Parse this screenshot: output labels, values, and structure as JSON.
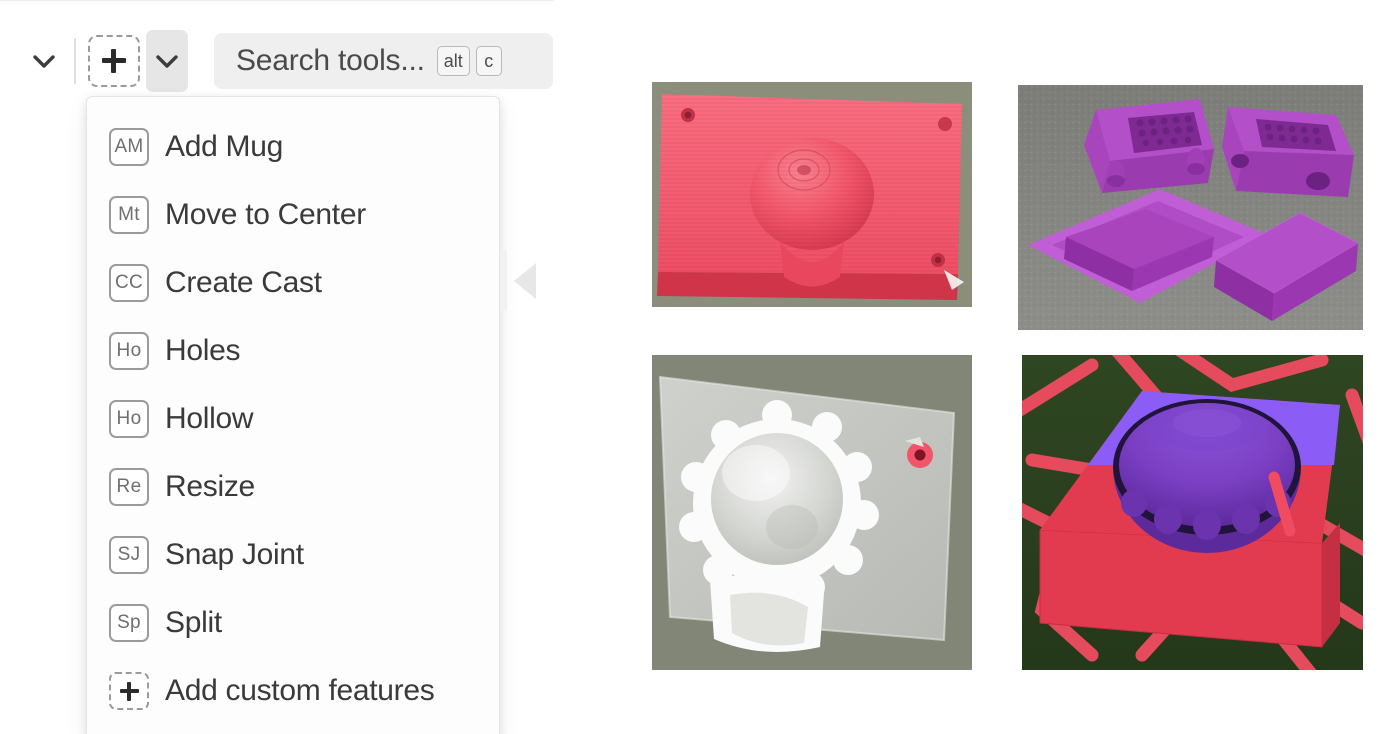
{
  "toolbar": {
    "collapse_chevron_icon": "chevron-down-icon",
    "add_tool_icon": "plus-icon",
    "add_tool_dropdown_icon": "chevron-down-icon",
    "search": {
      "placeholder": "Search tools...",
      "value": "",
      "shortcut_keys": [
        "alt",
        "c"
      ]
    }
  },
  "dropdown_menu": {
    "items": [
      {
        "badge": "AM",
        "label": "Add Mug",
        "badge_style": "solid"
      },
      {
        "badge": "Mt",
        "label": "Move to Center",
        "badge_style": "solid"
      },
      {
        "badge": "CC",
        "label": "Create Cast",
        "badge_style": "solid"
      },
      {
        "badge": "Ho",
        "label": "Holes",
        "badge_style": "solid"
      },
      {
        "badge": "Ho",
        "label": "Hollow",
        "badge_style": "solid"
      },
      {
        "badge": "Re",
        "label": "Resize",
        "badge_style": "solid"
      },
      {
        "badge": "SJ",
        "label": "Snap Joint",
        "badge_style": "solid"
      },
      {
        "badge": "Sp",
        "label": "Split",
        "badge_style": "solid"
      },
      {
        "badge": "+",
        "label": "Add custom features",
        "badge_style": "dashed"
      }
    ]
  },
  "panel": {
    "collapse_handle_icon": "triangle-left-icon"
  },
  "gallery": {
    "photos": [
      {
        "name": "red-dome-block",
        "description": "Red 3D-printed rectangular block with a printed dome on top, two screw holes at corners, on a green cloth background"
      },
      {
        "name": "grey-cast-mold",
        "description": "Grey translucent 3D-printed plate with a white spherical cast cavity and one red screw insert, on green cloth"
      },
      {
        "name": "purple-parts",
        "description": "Four purple 3D-printed mold parts with pin features on a grey concrete floor"
      },
      {
        "name": "render-cutaway",
        "description": "CAD render of a red box with purple cut plane revealing a hemispherical cavity, sitting on a red lattice over grass"
      }
    ]
  },
  "colors": {
    "panel_background": "#ffffff",
    "menu_background": "#fdfdfd",
    "menu_text": "#3a3a3a",
    "badge_border": "#9b9b9b",
    "search_background": "#efefef",
    "active_button_background": "#e6e6e6",
    "photo_red": "#f4566a",
    "photo_purple": "#9b3fb5",
    "photo_violet": "#8b5cf6",
    "photo_grey": "#c9cbc6"
  }
}
